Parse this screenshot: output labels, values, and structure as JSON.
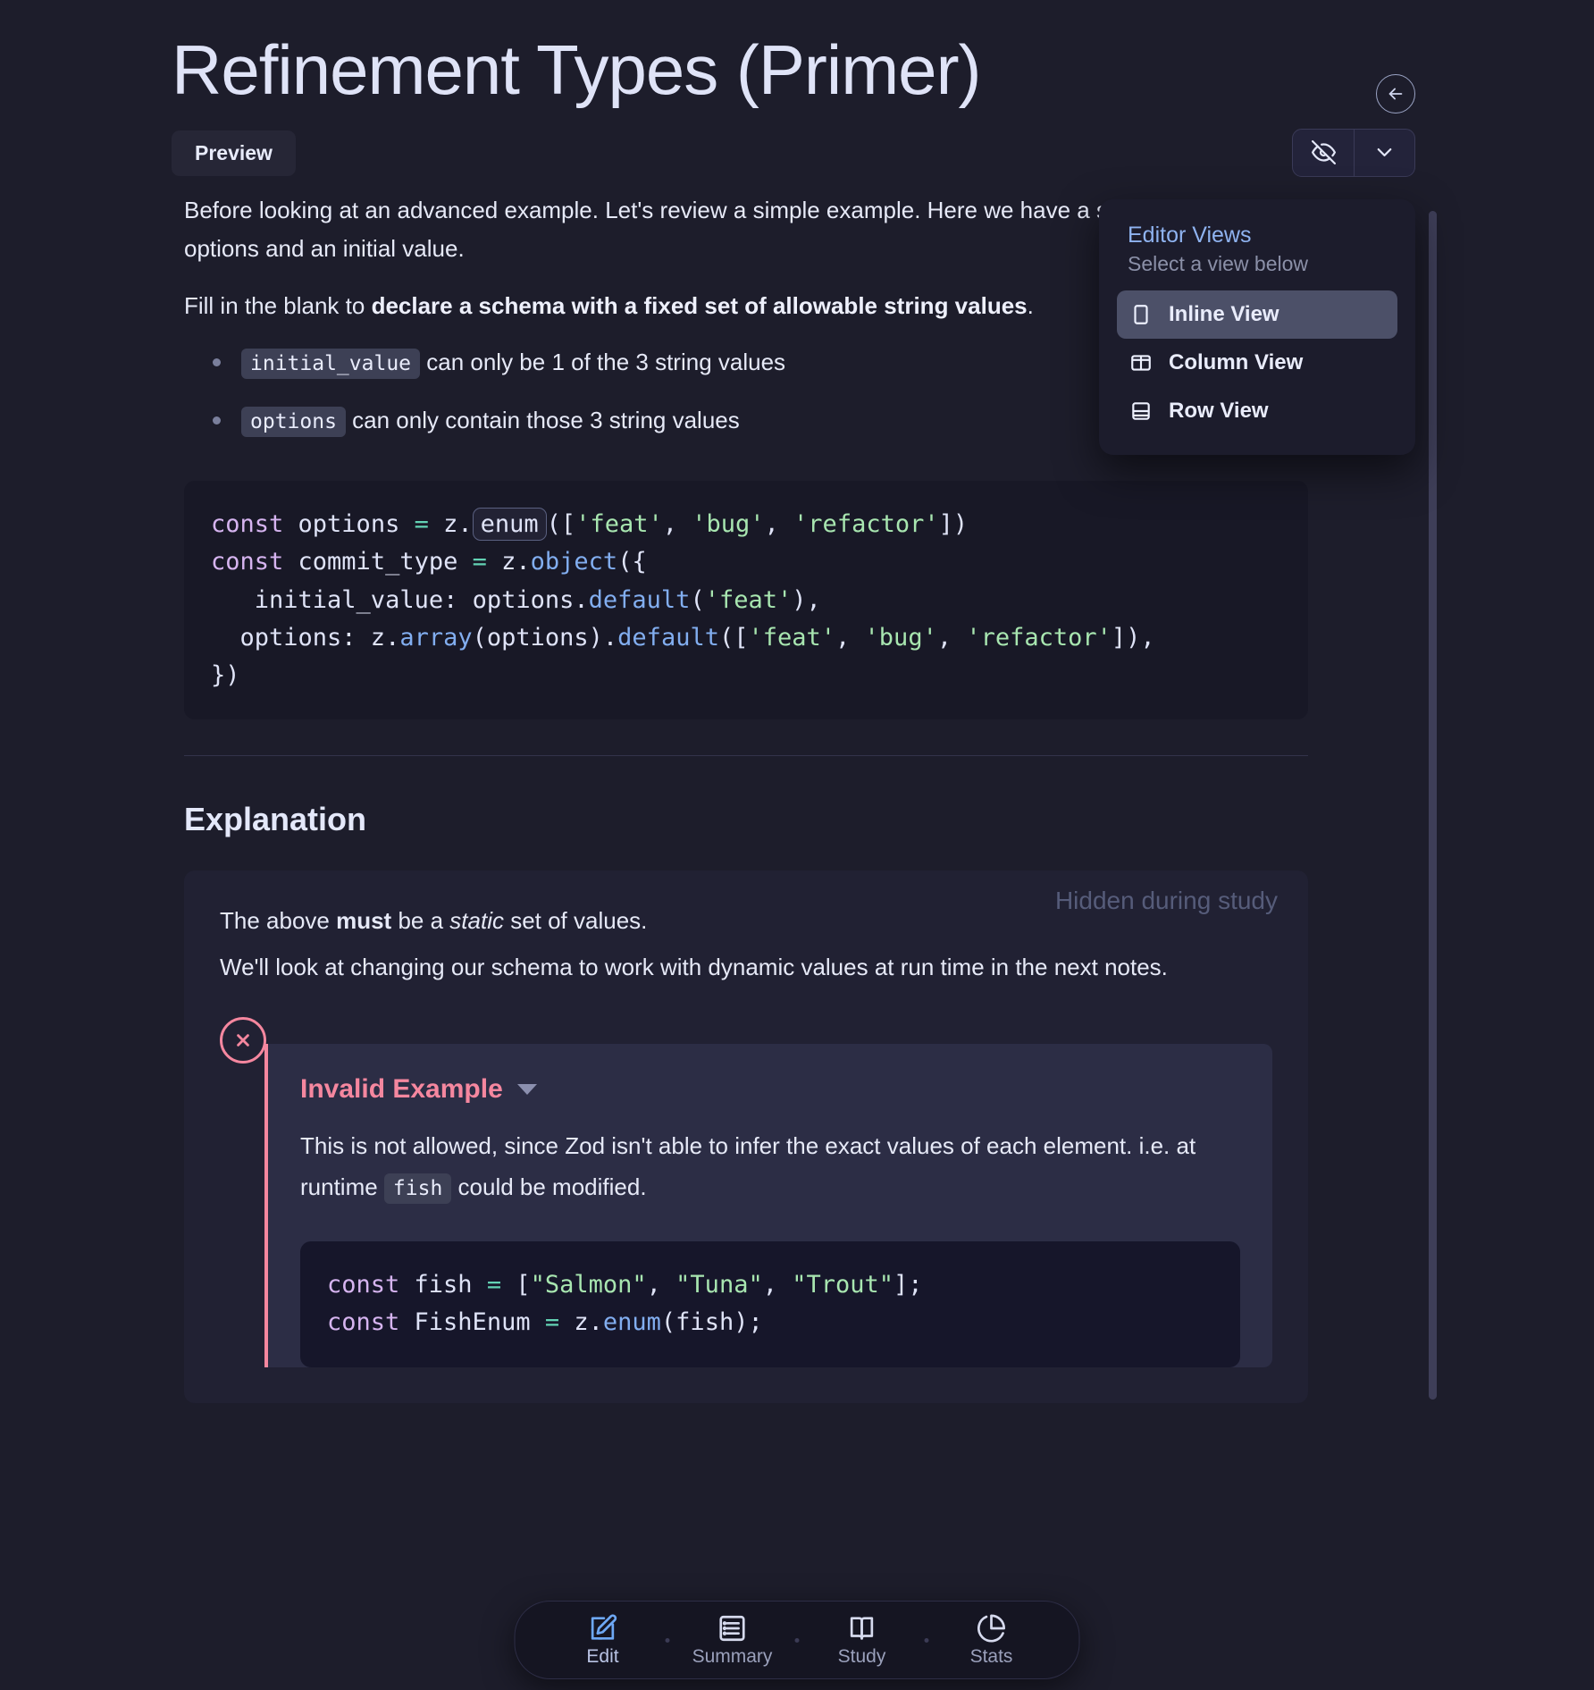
{
  "header": {
    "title": "Refinement Types (Primer)",
    "back_icon": "arrow-left-icon"
  },
  "toolbar": {
    "preview_label": "Preview",
    "hide_icon": "eye-off-icon",
    "chevron_icon": "chevron-down-icon"
  },
  "dropdown": {
    "title": "Editor Views",
    "subtitle": "Select a view below",
    "items": [
      {
        "label": "Inline View",
        "icon": "panel-single-icon",
        "active": true
      },
      {
        "label": "Column View",
        "icon": "panel-columns-icon",
        "active": false
      },
      {
        "label": "Row View",
        "icon": "panel-rows-icon",
        "active": false
      }
    ]
  },
  "body": {
    "paragraph_1": "Before looking at an advanced example. Let's review a simple example. Here we have a schema with a set of options and an initial value.",
    "paragraph_2_prefix": "Fill in the blank to ",
    "paragraph_2_bold": "declare a schema with a fixed set of allowable string values",
    "paragraph_2_suffix": ".",
    "bullets": [
      {
        "code": "initial_value",
        "text": " can only be 1 of the 3 string values"
      },
      {
        "code": "options",
        "text": " can only contain those 3 string values"
      }
    ]
  },
  "code_block_main": {
    "blank_token": "enum",
    "line1_a": "const",
    "line1_b": " options ",
    "line1_c": "=",
    "line1_d": " z.",
    "line1_e": "([",
    "line1_str1": "'feat'",
    "line1_comma1": ", ",
    "line1_str2": "'bug'",
    "line1_comma2": ", ",
    "line1_str3": "'refactor'",
    "line1_end": "])",
    "line2_a": "const",
    "line2_b": " commit_type ",
    "line2_c": "=",
    "line2_d": " z.",
    "line2_fn": "object",
    "line2_end": "({",
    "line3_a": "   initial_value: options.",
    "line3_fn": "default",
    "line3_open": "(",
    "line3_str": "'feat'",
    "line3_end": "),",
    "line4_a": "  options: z.",
    "line4_fn1": "array",
    "line4_mid": "(options).",
    "line4_fn2": "default",
    "line4_open": "([",
    "line4_str1": "'feat'",
    "line4_c1": ", ",
    "line4_str2": "'bug'",
    "line4_c2": ", ",
    "line4_str3": "'refactor'",
    "line4_end": "]),",
    "line5": "})"
  },
  "explanation": {
    "heading": "Explanation",
    "hidden_label": "Hidden during study",
    "line1_a": "The above ",
    "line1_bold": "must",
    "line1_b": " be a ",
    "line1_italic": "static",
    "line1_c": " set of values.",
    "line2": "We'll look at changing our schema to work with dynamic values at run time in the next notes."
  },
  "callout": {
    "badge_icon": "x-circle-icon",
    "title": "Invalid Example",
    "collapse_icon": "triangle-down-icon",
    "body_part1": "This is not allowed, since Zod isn't able to infer the exact values of each element. i.e. at runtime ",
    "body_code": "fish",
    "body_part2": " could be modified.",
    "code": {
      "l1_kw": "const",
      "l1_name": " fish ",
      "l1_op": "=",
      "l1_open": " [",
      "l1_s1": "\"Salmon\"",
      "l1_c1": ", ",
      "l1_s2": "\"Tuna\"",
      "l1_c2": ", ",
      "l1_s3": "\"Trout\"",
      "l1_end": "];",
      "l2_kw": "const",
      "l2_name": " FishEnum ",
      "l2_op": "=",
      "l2_dot": " z.",
      "l2_fn": "enum",
      "l2_end": "(fish);"
    }
  },
  "bottom_nav": {
    "items": [
      {
        "label": "Edit",
        "icon": "pencil-square-icon",
        "active": true
      },
      {
        "label": "Summary",
        "icon": "list-icon",
        "active": false
      },
      {
        "label": "Study",
        "icon": "book-open-icon",
        "active": false
      },
      {
        "label": "Stats",
        "icon": "pie-chart-icon",
        "active": false
      }
    ]
  },
  "colors": {
    "background": "#1d1d2b",
    "accent_blue": "#6ea8f5",
    "accent_pink": "#f5879f",
    "code_keyword": "#d6b4f0",
    "code_string": "#a8e6b0",
    "code_function": "#82aef0",
    "code_operator": "#63d2b4"
  }
}
